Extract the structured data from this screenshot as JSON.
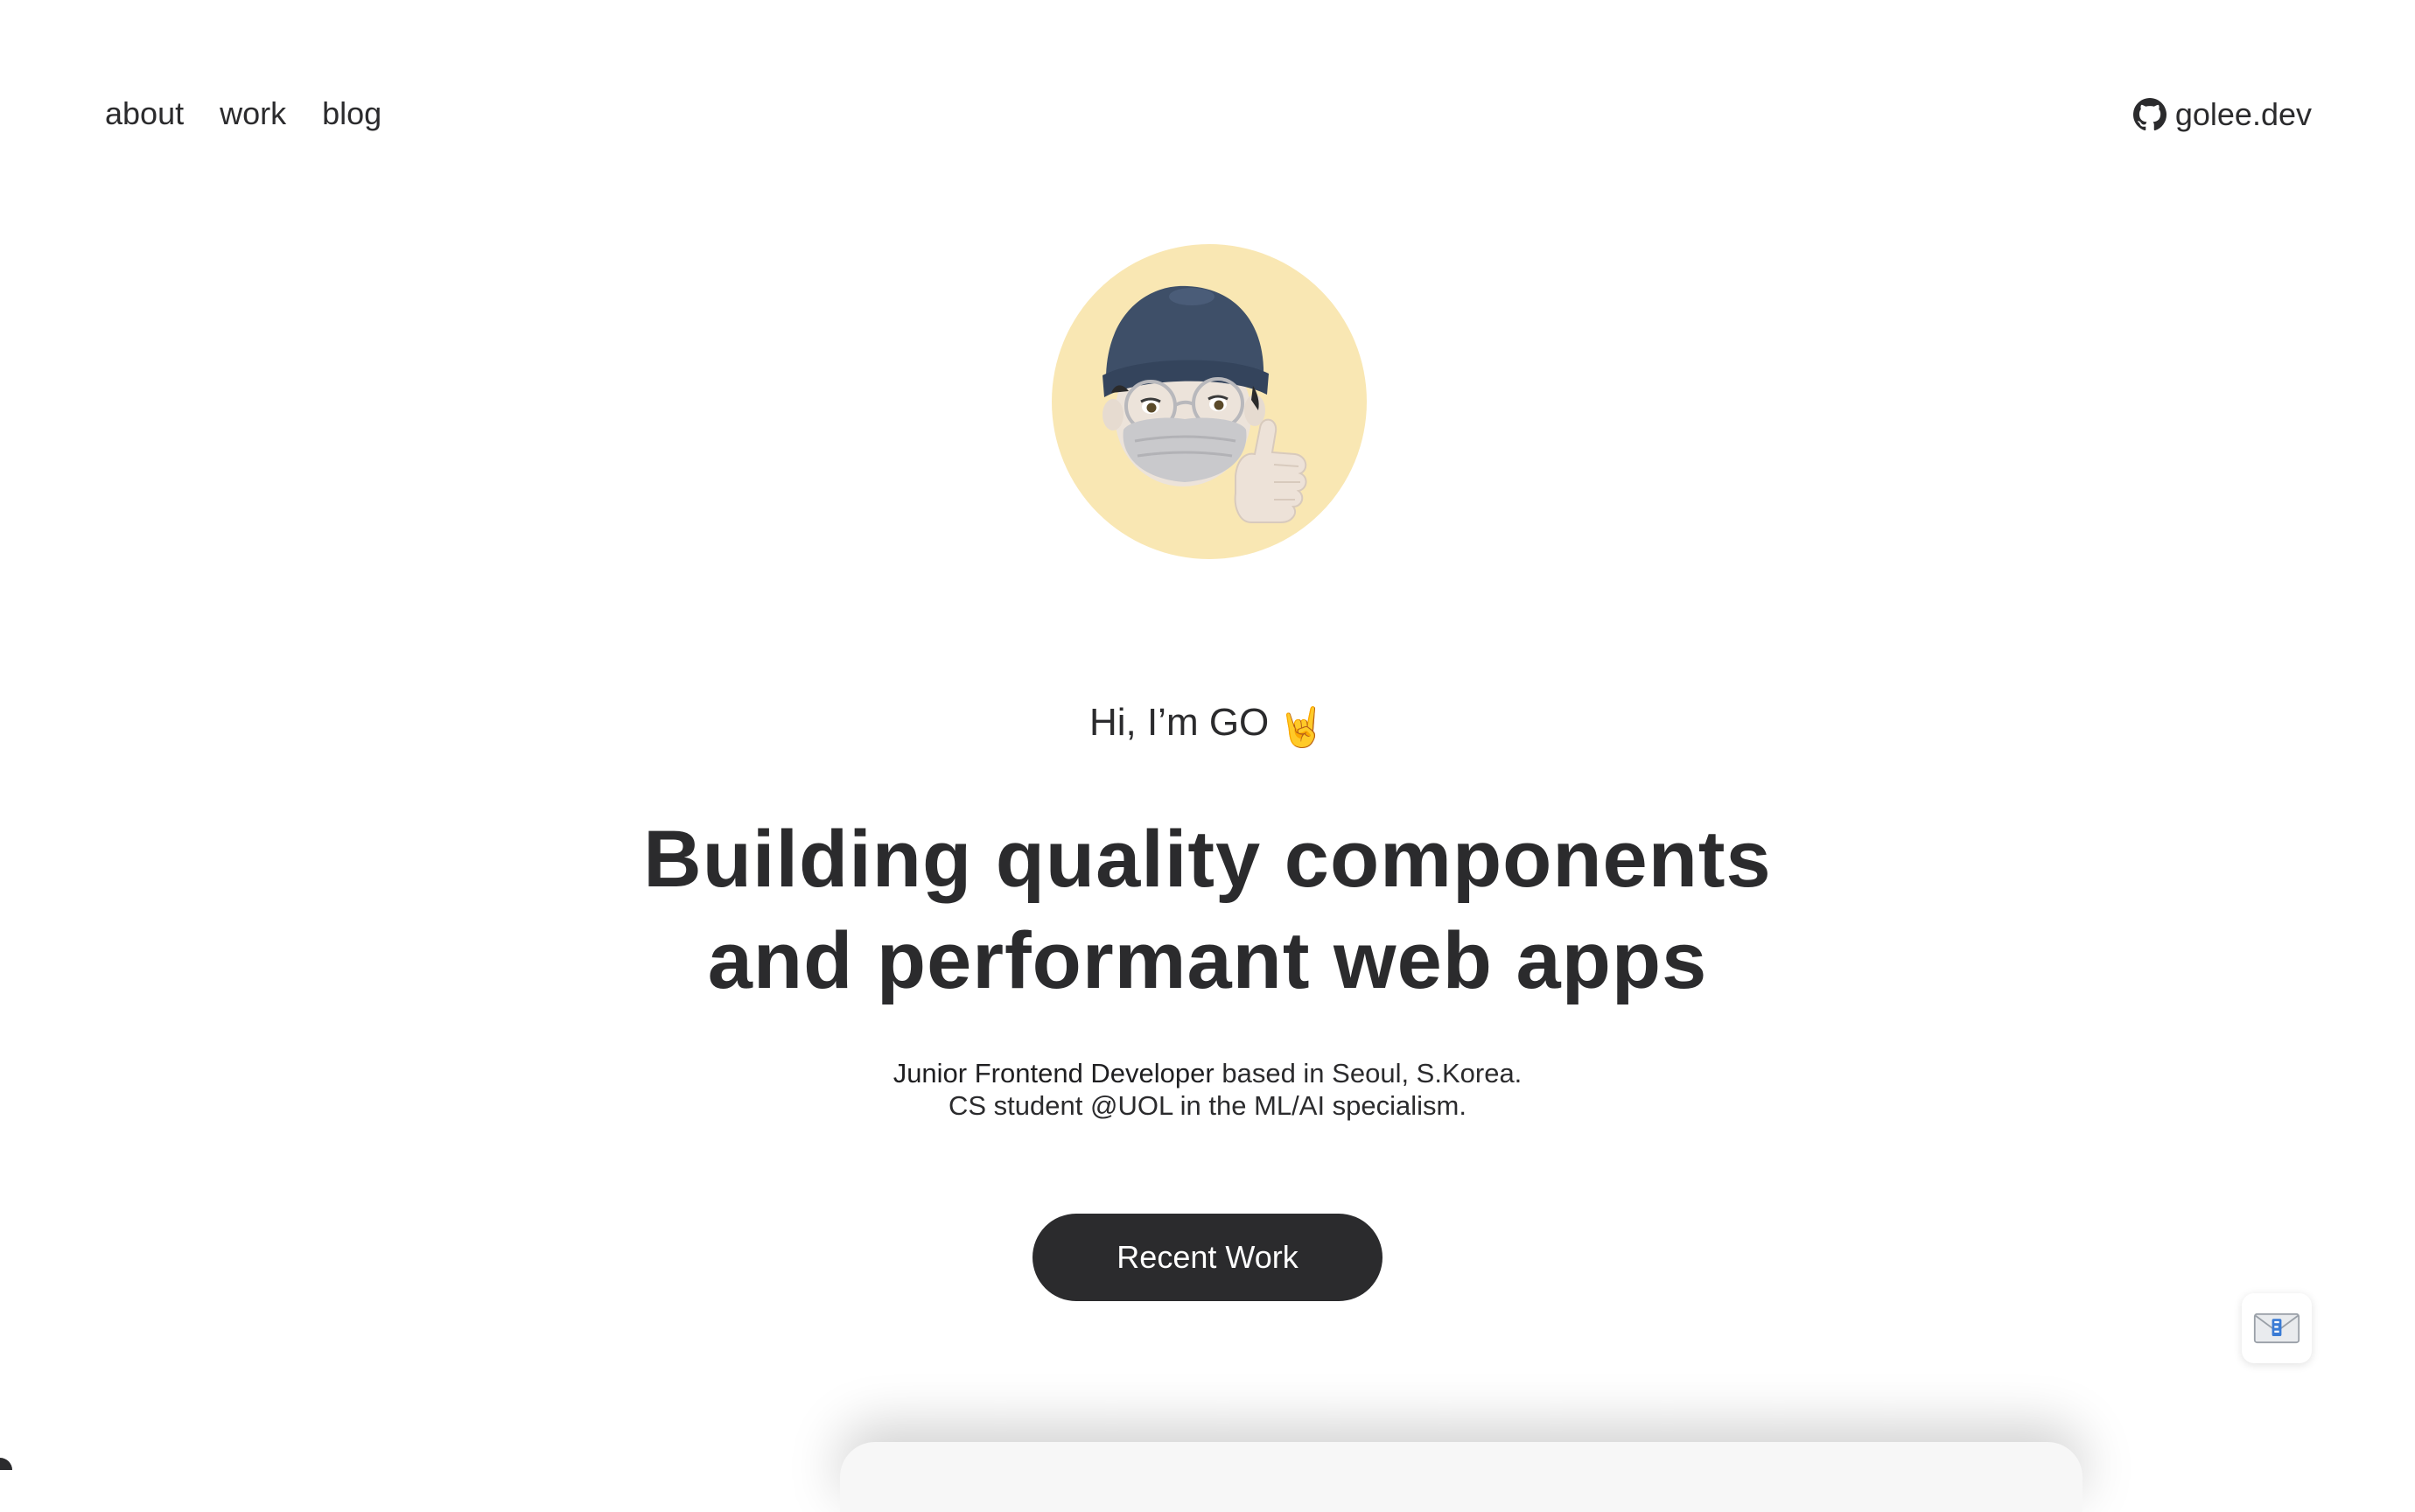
{
  "nav": {
    "items": [
      {
        "label": "about"
      },
      {
        "label": "work"
      },
      {
        "label": "blog"
      }
    ],
    "brand": {
      "label": "golee.dev",
      "icon": "github-icon"
    }
  },
  "hero": {
    "avatar": {
      "description": "memoji-avatar-thumbs-up",
      "background": "#f9e7b3"
    },
    "greeting": "Hi, I’m GO",
    "greeting_emoji": "🤘",
    "headline": [
      "Building quality components",
      "and performant web apps"
    ],
    "subtitle": {
      "role": "Junior Frontend Developer",
      "line1_rest": " based in Seoul, S.Korea.",
      "line2": "CS student @UOL in the ML/AI specialism."
    },
    "cta_label": "Recent Work"
  },
  "floating": {
    "icon": "mail-icon"
  },
  "colors": {
    "text": "#2b2b2d",
    "button_bg": "#2b2b2d",
    "avatar_bg": "#f9e7b3"
  }
}
